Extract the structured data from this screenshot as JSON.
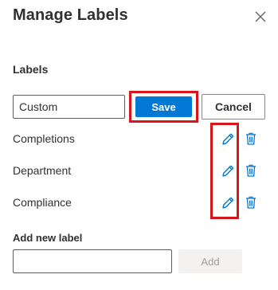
{
  "dialog": {
    "title": "Manage Labels",
    "close_icon": "close-icon"
  },
  "labels_section": {
    "heading": "Labels",
    "edit_input_value": "Custom",
    "save_label": "Save",
    "cancel_label": "Cancel",
    "items": [
      {
        "name": "Completions",
        "edit_icon": "pencil-icon",
        "delete_icon": "trash-icon"
      },
      {
        "name": "Department",
        "edit_icon": "pencil-icon",
        "delete_icon": "trash-icon"
      },
      {
        "name": "Compliance",
        "edit_icon": "pencil-icon",
        "delete_icon": "trash-icon"
      }
    ]
  },
  "add_section": {
    "heading": "Add new label",
    "input_value": "",
    "add_label": "Add"
  },
  "colors": {
    "primary": "#0078d4",
    "highlight": "#d6161b",
    "text": "#323130",
    "disabled_bg": "#f3f2f1",
    "disabled_text": "#a19f9d"
  }
}
